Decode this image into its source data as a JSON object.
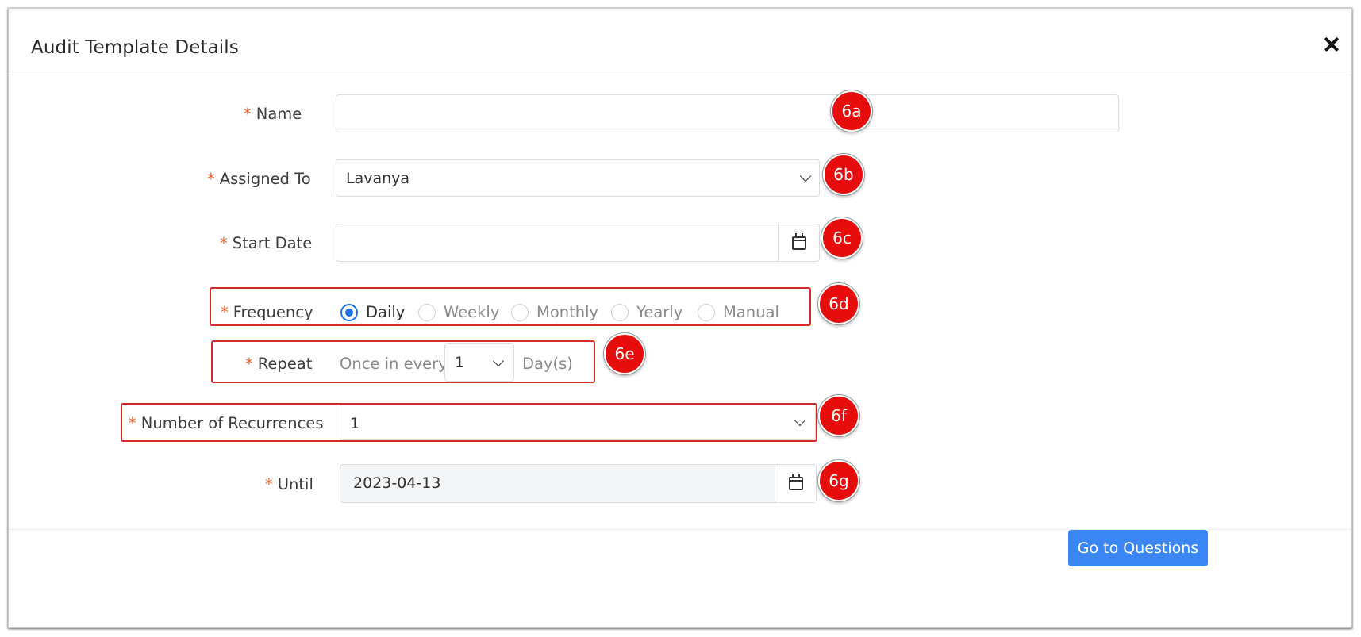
{
  "modal": {
    "title": "Audit Template Details",
    "close_label": "×"
  },
  "form": {
    "required_mark": "*",
    "name": {
      "label": "Name",
      "value": ""
    },
    "assigned_to": {
      "label": "Assigned To",
      "value": "Lavanya"
    },
    "start_date": {
      "label": "Start Date",
      "value": ""
    },
    "frequency": {
      "label": "Frequency",
      "options": [
        "Daily",
        "Weekly",
        "Monthly",
        "Yearly",
        "Manual"
      ],
      "selected": "Daily"
    },
    "repeat": {
      "label": "Repeat",
      "prefix": "Once in every",
      "value": "1",
      "suffix": "Day(s)"
    },
    "recurrences": {
      "label": "Number of Recurrences",
      "value": "1"
    },
    "until": {
      "label": "Until",
      "value": "2023-04-13"
    }
  },
  "badges": [
    "6a",
    "6b",
    "6c",
    "6d",
    "6e",
    "6f",
    "6g"
  ],
  "footer": {
    "submit_label": "Go to Questions"
  },
  "colors": {
    "accent": "#3a86f5",
    "required": "#e8612a",
    "highlight_border": "#d62a2a",
    "badge": "#e80d0d",
    "radio_checked": "#1a73e8"
  },
  "icons": {
    "close": "close-icon",
    "calendar": "calendar-icon",
    "dropdown": "chevron-down-icon"
  }
}
